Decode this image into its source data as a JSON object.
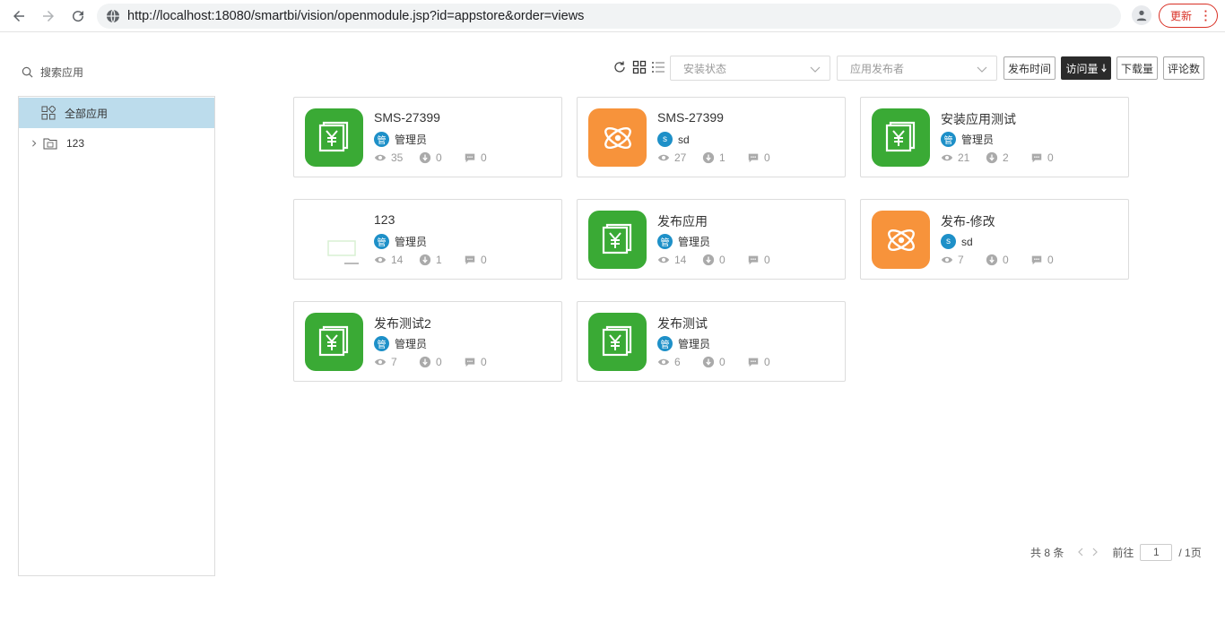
{
  "browser": {
    "url": "http://localhost:18080/smartbi/vision/openmodule.jsp?id=appstore&order=views",
    "update_label": "更新"
  },
  "sidebar": {
    "search_placeholder": "搜索应用",
    "items": [
      {
        "label": "全部应用",
        "icon": "apps-grid-icon",
        "selected": true
      },
      {
        "label": "123",
        "icon": "folder-icon",
        "selected": false
      }
    ]
  },
  "toolbar": {
    "install_status_placeholder": "安装状态",
    "publisher_placeholder": "应用发布者",
    "sort_buttons": [
      {
        "label": "发布时间",
        "active": false
      },
      {
        "label": "访问量",
        "active": true
      },
      {
        "label": "下载量",
        "active": false
      },
      {
        "label": "评论数",
        "active": false
      }
    ]
  },
  "apps": [
    {
      "title": "SMS-27399",
      "author": "管理员",
      "avatar": "管",
      "views": "35",
      "downloads": "0",
      "comments": "0",
      "icon": "green"
    },
    {
      "title": "SMS-27399",
      "author": "sd",
      "avatar": "s",
      "views": "27",
      "downloads": "1",
      "comments": "0",
      "icon": "orange"
    },
    {
      "title": "安装应用测试",
      "author": "管理员",
      "avatar": "管",
      "views": "21",
      "downloads": "2",
      "comments": "0",
      "icon": "green"
    },
    {
      "title": "123",
      "author": "管理员",
      "avatar": "管",
      "views": "14",
      "downloads": "1",
      "comments": "0",
      "icon": "thumb"
    },
    {
      "title": "发布应用",
      "author": "管理员",
      "avatar": "管",
      "views": "14",
      "downloads": "0",
      "comments": "0",
      "icon": "green"
    },
    {
      "title": "发布-修改",
      "author": "sd",
      "avatar": "s",
      "views": "7",
      "downloads": "0",
      "comments": "0",
      "icon": "orange"
    },
    {
      "title": "发布测试2",
      "author": "管理员",
      "avatar": "管",
      "views": "7",
      "downloads": "0",
      "comments": "0",
      "icon": "green"
    },
    {
      "title": "发布测试",
      "author": "管理员",
      "avatar": "管",
      "views": "6",
      "downloads": "0",
      "comments": "0",
      "icon": "green"
    }
  ],
  "pagination": {
    "total_label": "共 8 条",
    "goto_label": "前往",
    "current_page": "1",
    "total_pages_label": "/ 1页"
  },
  "colors": {
    "accent_green": "#3aaa35",
    "accent_orange": "#f7933b",
    "avatar_blue": "#1e90c8",
    "selected_bg": "#bcdcec",
    "active_sort_bg": "#2b2b2b"
  }
}
